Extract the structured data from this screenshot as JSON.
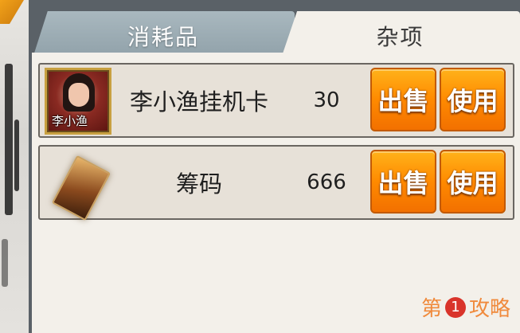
{
  "tabs": [
    {
      "label": "消耗品",
      "active": false
    },
    {
      "label": "杂项",
      "active": true
    }
  ],
  "items": [
    {
      "name": "李小渔挂机卡",
      "count": "30",
      "icon": "portrait-card-icon",
      "icon_text": "李小渔",
      "sell_label": "出售",
      "use_label": "使用"
    },
    {
      "name": "筹码",
      "count": "666",
      "icon": "chip-card-icon",
      "sell_label": "出售",
      "use_label": "使用"
    }
  ],
  "watermark": {
    "prefix": "第",
    "number": "1",
    "suffix": "攻略"
  },
  "colors": {
    "button_orange": "#ff8a00",
    "tab_inactive": "#9aabb3",
    "panel_bg": "#f3f0ea",
    "watermark": "#f08a3c"
  }
}
